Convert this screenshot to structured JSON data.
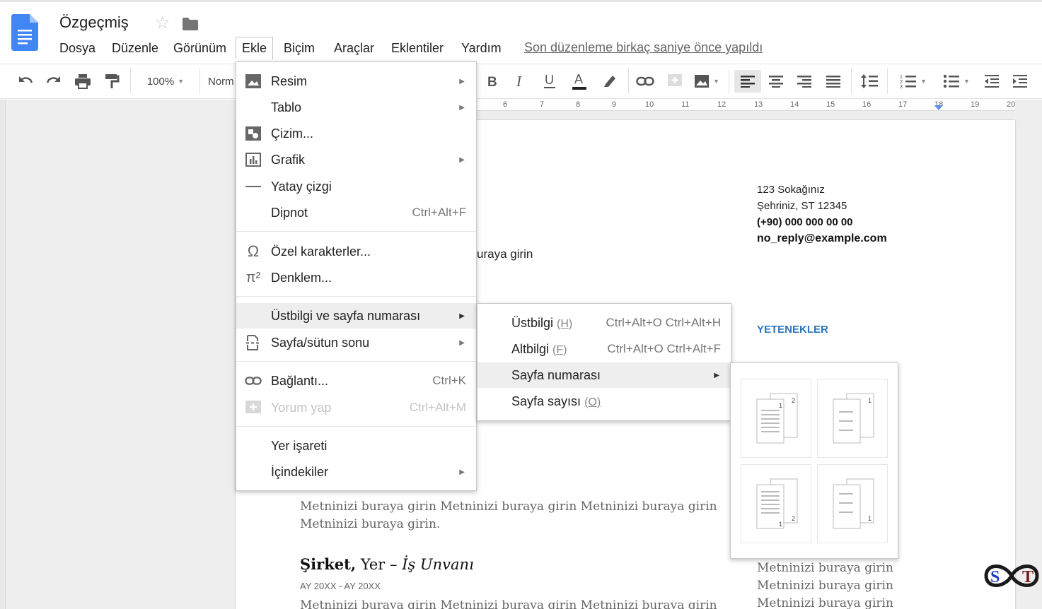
{
  "app": {
    "title": "Özgeçmiş",
    "icons": {
      "logo": "google-docs-icon",
      "star": "star-icon",
      "folder": "folder-icon"
    },
    "last_edit": "Son düzenleme birkaç saniye önce yapıldı"
  },
  "menubar": [
    "Dosya",
    "Düzenle",
    "Görünüm",
    "Ekle",
    "Biçim",
    "Araçlar",
    "Eklentiler",
    "Yardım"
  ],
  "toolbar": {
    "zoom": "100%",
    "style": "Norm",
    "buttons": [
      "undo-icon",
      "redo-icon",
      "print-icon",
      "paint-format-icon",
      "bold-icon",
      "italic-icon",
      "underline-icon",
      "text-color-icon",
      "highlight-icon",
      "link-icon",
      "comment-icon",
      "image-icon",
      "align-left-icon",
      "align-center-icon",
      "align-right-icon",
      "justify-icon",
      "line-spacing-icon",
      "numbered-list-icon",
      "bulleted-list-icon",
      "decrease-indent-icon",
      "increase-indent-icon"
    ]
  },
  "ruler": [
    "6",
    "7",
    "8",
    "9",
    "10",
    "11",
    "12",
    "13",
    "14",
    "15",
    "16",
    "17",
    "18",
    "19",
    "20"
  ],
  "document": {
    "address": [
      "123 Sokağınız",
      "Şehriniz, ST 12345",
      "(+90) 000 000 00 00",
      "no_reply@example.com"
    ],
    "partial_line": "uraya girin",
    "skills_heading": "YETENEKLER",
    "body_line1": "Metninizi buraya girin Metninizi buraya girin Metninizi buraya girin",
    "body_line2": "Metninizi buraya girin.",
    "job_company": "Şirket,",
    "job_place": " Yer",
    "job_dash": " – ",
    "job_title": "İş Unvanı",
    "job_dates": "AY 20XX - AY 20XX",
    "body_line3": "Metninizi buraya girin Metninizi buraya girin Metninizi buraya girin",
    "right_lines": [
      "Metninizi buraya girin",
      "Metninizi buraya girin",
      "Metninizi buraya girin"
    ]
  },
  "insert_menu": {
    "items": [
      {
        "label": "Resim",
        "icon": "image-icon",
        "submenu": true
      },
      {
        "label": "Tablo",
        "submenu": true
      },
      {
        "label": "Çizim...",
        "icon": "drawing-icon"
      },
      {
        "label": "Grafik",
        "icon": "chart-icon",
        "submenu": true
      },
      {
        "label": "Yatay çizgi",
        "icon": "horizontal-line-icon"
      },
      {
        "label": "Dipnot",
        "shortcut": "Ctrl+Alt+F"
      },
      {
        "label": "Özel karakterler...",
        "icon": "omega-icon"
      },
      {
        "label": "Denklem...",
        "icon": "pi-icon"
      },
      {
        "label": "Üstbilgi ve sayfa numarası",
        "submenu": true,
        "highlighted": true
      },
      {
        "label": "Sayfa/sütun sonu",
        "icon": "page-break-icon",
        "submenu": true
      },
      {
        "label": "Bağlantı...",
        "icon": "link-icon",
        "shortcut": "Ctrl+K"
      },
      {
        "label": "Yorum yap",
        "icon": "comment-add-icon",
        "shortcut": "Ctrl+Alt+M",
        "disabled": true
      },
      {
        "label": "Yer işareti"
      },
      {
        "label": "İçindekiler",
        "submenu": true
      }
    ]
  },
  "header_submenu": {
    "items": [
      {
        "label": "Üstbilgi",
        "key": "(H)",
        "shortcut": "Ctrl+Alt+O Ctrl+Alt+H"
      },
      {
        "label": "Altbilgi",
        "key": "(F)",
        "shortcut": "Ctrl+Alt+O Ctrl+Alt+F"
      },
      {
        "label": "Sayfa numarası",
        "submenu": true,
        "highlighted": true
      },
      {
        "label": "Sayfa sayısı",
        "key": "(O)"
      }
    ]
  },
  "page_number_options": [
    {
      "position": "header-right",
      "include_first_page": true
    },
    {
      "position": "header-right",
      "include_first_page": false
    },
    {
      "position": "footer-right",
      "include_first_page": true
    },
    {
      "position": "footer-right",
      "include_first_page": false
    }
  ],
  "colors": {
    "accent": "#2a75bb",
    "menu_highlight": "#eeeeee",
    "logo": "#4285f4"
  }
}
